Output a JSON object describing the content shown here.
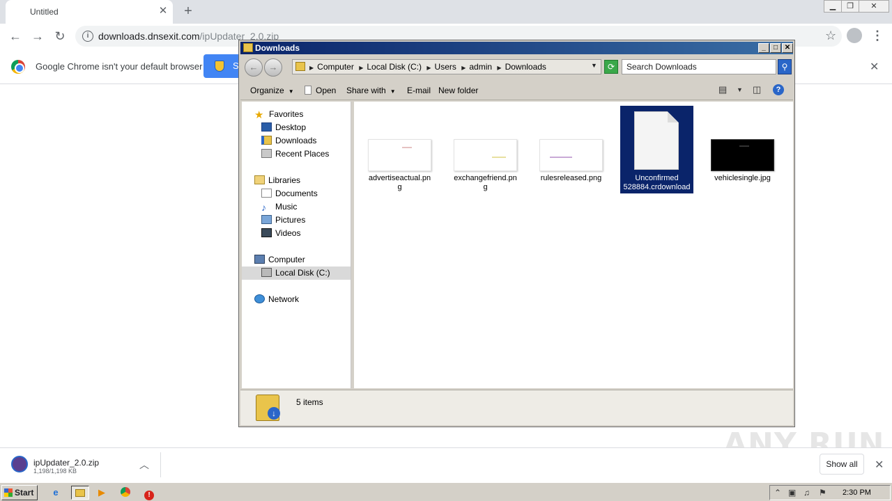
{
  "browser": {
    "tab_title": "Untitled",
    "tab_close": "✕",
    "new_tab": "+",
    "url_host": "downloads.dnsexit.com",
    "url_path": "/ipUpdater_2.0.zip",
    "infobar_text": "Google Chrome isn't your default browser",
    "infobar_button": "S",
    "infobar_close": "✕"
  },
  "explorer": {
    "title": "Downloads",
    "breadcrumbs": [
      "Computer",
      "Local Disk (C:)",
      "Users",
      "admin",
      "Downloads"
    ],
    "search_placeholder": "Search Downloads",
    "commands": {
      "organize": "Organize",
      "open": "Open",
      "share_with": "Share with",
      "email": "E-mail",
      "new_folder": "New folder"
    },
    "nav": {
      "favorites": "Favorites",
      "desktop": "Desktop",
      "downloads": "Downloads",
      "recent": "Recent Places",
      "libraries": "Libraries",
      "documents": "Documents",
      "music": "Music",
      "pictures": "Pictures",
      "videos": "Videos",
      "computer": "Computer",
      "local_disk": "Local Disk (C:)",
      "network": "Network"
    },
    "files": [
      {
        "line1": "advertiseactual.pn",
        "line2": "g"
      },
      {
        "line1": "exchangefriend.pn",
        "line2": "g"
      },
      {
        "line1": "rulesreleased.png",
        "line2": ""
      },
      {
        "line1": "Unconfirmed",
        "line2": "528884.crdownload"
      },
      {
        "line1": "vehiclesingle.jpg",
        "line2": ""
      }
    ],
    "item_count": "5 items"
  },
  "downloads_shelf": {
    "file_name": "ipUpdater_2.0.zip",
    "file_size": "1,198/1,198 KB",
    "show_all": "Show all",
    "close": "✕"
  },
  "watermark": "ANY RUN",
  "taskbar": {
    "start": "Start",
    "clock": "2:30 PM"
  }
}
